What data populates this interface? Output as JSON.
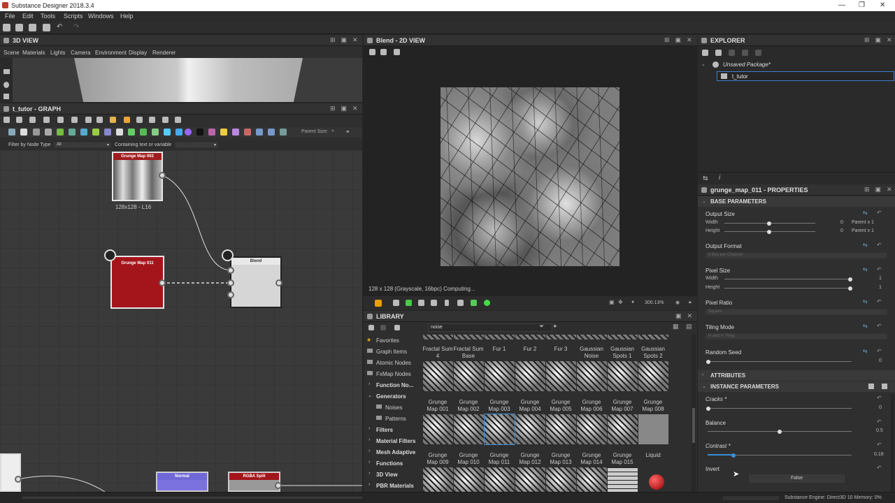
{
  "window": {
    "title": "Substance Designer 2018.3.4"
  },
  "menu": [
    "File",
    "Edit",
    "Tools",
    "Scripts",
    "Windows",
    "Help"
  ],
  "view3d": {
    "title": "3D VIEW",
    "menu": [
      "Scene",
      "Materials",
      "Lights",
      "Camera",
      "Environment",
      "Display",
      "Renderer"
    ]
  },
  "graph": {
    "title": "t_tutor - GRAPH",
    "filter_label": "Filter by Node Type",
    "filter_value": "All",
    "contains_label": "Containing text or variable",
    "parent_size": "Parent Size:",
    "nodes": {
      "grunge002": "Grunge Map 002",
      "grunge002_size": "128x128 - L16",
      "grunge011": "Grunge Map 011",
      "blend": "Blend",
      "normal": "Normal",
      "rgbasplit": "RGBA Split"
    }
  },
  "view2d": {
    "title": "Blend - 2D VIEW",
    "status": "128 x 128 (Grayscale, 16bpc) Computing...",
    "zoom": "300.13%"
  },
  "library": {
    "title": "LIBRARY",
    "search": "noise",
    "categories": [
      "Favorites",
      "Graph Items",
      "Atomic Nodes",
      "FxMap Nodes",
      "Function No...",
      "Generators",
      "Noises",
      "Patterns",
      "Filters",
      "Material Filters",
      "Mesh Adaptive",
      "Functions",
      "3D View",
      "PBR Materials"
    ],
    "row1": [
      "Fractal Sum 4",
      "Fractal Sum Base",
      "Fur 1",
      "Fur 2",
      "Fur 3",
      "Gaussian Noise",
      "Gaussian Spots 1",
      "Gaussian Spots 2"
    ],
    "row2": [
      "Grunge Map 001",
      "Grunge Map 002",
      "Grunge Map 003",
      "Grunge Map 004",
      "Grunge Map 005",
      "Grunge Map 006",
      "Grunge Map 007",
      "Grunge Map 008"
    ],
    "row3": [
      "Grunge Map 009",
      "Grunge Map 010",
      "Grunge Map 011",
      "Grunge Map 012",
      "Grunge Map 013",
      "Grunge Map 014",
      "Grunge Map 015",
      "Liquid"
    ]
  },
  "explorer": {
    "title": "EXPLORER",
    "package": "Unsaved Package*",
    "item": "t_tutor"
  },
  "props": {
    "title": "grunge_map_011 - PROPERTIES",
    "base": "BASE PARAMETERS",
    "output_size": "Output Size",
    "width": "Width",
    "height": "Height",
    "w_val": "0",
    "w_par": "Parent x 1",
    "h_val": "0",
    "h_par": "Parent x 1",
    "output_format": "Output Format",
    "format_val": "8 Bits per Channel",
    "pixel_size": "Pixel Size",
    "ps_w": "1",
    "ps_h": "1",
    "pixel_ratio": "Pixel Ratio",
    "ratio_val": "Square",
    "tiling_mode": "Tiling Mode",
    "tiling_val": "H and V Tiling",
    "random_seed": "Random Seed",
    "seed_val": "0",
    "attributes": "ATTRIBUTES",
    "instance": "INSTANCE PARAMETERS",
    "cracks": "Cracks *",
    "cracks_val": "0",
    "balance": "Balance",
    "balance_val": "0.5",
    "contrast": "Contrast *",
    "contrast_val": "0.18",
    "invert": "Invert",
    "invert_val": "False"
  },
  "statusbar": "Substance Engine: Direct3D 10  Memory: 0%"
}
